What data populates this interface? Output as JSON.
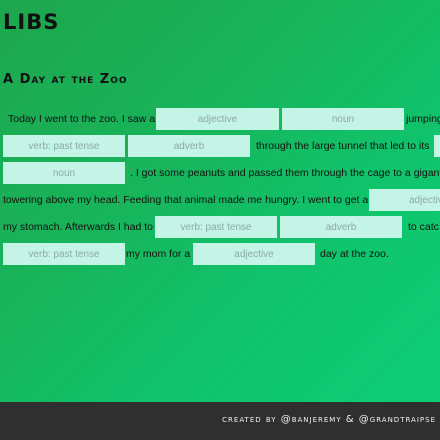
{
  "app": {
    "title": "LIBS"
  },
  "story": {
    "title": "A Day at the Zoo",
    "lines": [
      {
        "t1": "Today I went to the zoo. I saw a",
        "b1": "adjective",
        "b2": "noun",
        "t2": "jumping"
      },
      {
        "b1": "verb: past tense",
        "b2": "adverb",
        "t1": "through the large tunnel that led to its"
      },
      {
        "b1": "noun",
        "t1": ". I got some peanuts and passed them through the cage to a gigant",
        "b2": ""
      },
      {
        "t1": "towering above my head. Feeding that animal made me hungry. I went to get a",
        "b1": "adjective"
      },
      {
        "t1": "my stomach. Afterwards I had to",
        "b1": "verb: past tense",
        "b2": "adverb",
        "t2": "to catc"
      },
      {
        "b1": "verb: past tense",
        "t1": "my mom for a",
        "b2": "adjective",
        "t2": "day at the zoo."
      }
    ]
  },
  "footer": {
    "credit": "created by @banjeremy & @grandtraipse"
  }
}
